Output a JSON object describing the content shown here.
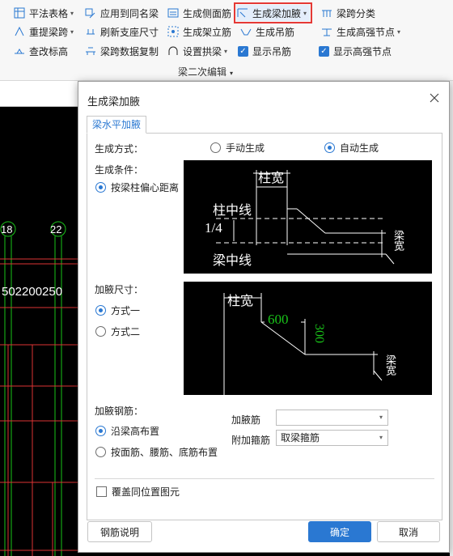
{
  "ribbon": {
    "row1": [
      {
        "label": "平法表格",
        "icon": "table-icon",
        "dropdown": true
      },
      {
        "label": "应用到同名梁",
        "icon": "apply-same-icon",
        "dropdown": false
      },
      {
        "label": "生成侧面筋",
        "icon": "side-bar-icon",
        "dropdown": false
      },
      {
        "label": "生成梁加腋",
        "icon": "haunch-icon",
        "dropdown": true
      },
      {
        "label": "梁跨分类",
        "icon": "span-classify-icon",
        "dropdown": false
      }
    ],
    "row2": [
      {
        "label": "重提梁跨",
        "icon": "re-extract-icon",
        "dropdown": true
      },
      {
        "label": "刷新支座尺寸",
        "icon": "refresh-support-icon",
        "dropdown": false
      },
      {
        "label": "生成架立筋",
        "icon": "erection-bar-icon",
        "dropdown": false
      },
      {
        "label": "生成吊筋",
        "icon": "hanger-bar-icon",
        "dropdown": false
      },
      {
        "label": "生成高强节点",
        "icon": "high-strength-node-icon",
        "dropdown": true
      }
    ],
    "row3": [
      {
        "label": "查改标高",
        "icon": "elevation-icon",
        "dropdown": false
      },
      {
        "label": "梁跨数据复制",
        "icon": "copy-span-icon",
        "dropdown": false
      },
      {
        "label": "设置拱梁",
        "icon": "arch-beam-icon",
        "dropdown": true
      },
      {
        "label": "显示吊筋",
        "icon": "checkbox-icon",
        "checked": true
      },
      {
        "label": "显示高强节点",
        "icon": "checkbox-icon",
        "checked": true
      }
    ],
    "group_label": "梁二次编辑"
  },
  "cad": {
    "axis_left": "18",
    "axis_right": "22",
    "dims": "502200250"
  },
  "dialog": {
    "title": "生成梁加腋",
    "tab": "梁水平加腋",
    "method_label": "生成方式：",
    "method_manual": "手动生成",
    "method_auto": "自动生成",
    "condition_label": "生成条件：",
    "condition_option": "按梁柱偏心距离",
    "figure1": {
      "col_width": "柱宽",
      "col_center": "柱中线",
      "ratio": "1/4",
      "beam_center": "梁中线",
      "beam_width": "梁宽"
    },
    "size_label": "加腋尺寸：",
    "size_opt1": "方式一",
    "size_opt2": "方式二",
    "figure2": {
      "col_width": "柱宽",
      "dim_600": "600",
      "dim_300": "300",
      "beam_width": "梁宽"
    },
    "rebar_label": "加腋钢筋：",
    "rebar_opt1": "沿梁高布置",
    "rebar_opt2": "按面筋、腰筋、底筋布置",
    "haunch_rebar_label": "加腋筋",
    "haunch_rebar_value": "",
    "extra_stirrup_label": "附加箍筋",
    "extra_stirrup_value": "取梁箍筋",
    "overwrite_label": "覆盖同位置图元",
    "btn_help": "钢筋说明",
    "btn_ok": "确定",
    "btn_cancel": "取消"
  },
  "colors": {
    "accent": "#2a78d2",
    "highlight": "#e53935",
    "cad_bg": "#000000",
    "cad_green": "#19c419"
  }
}
